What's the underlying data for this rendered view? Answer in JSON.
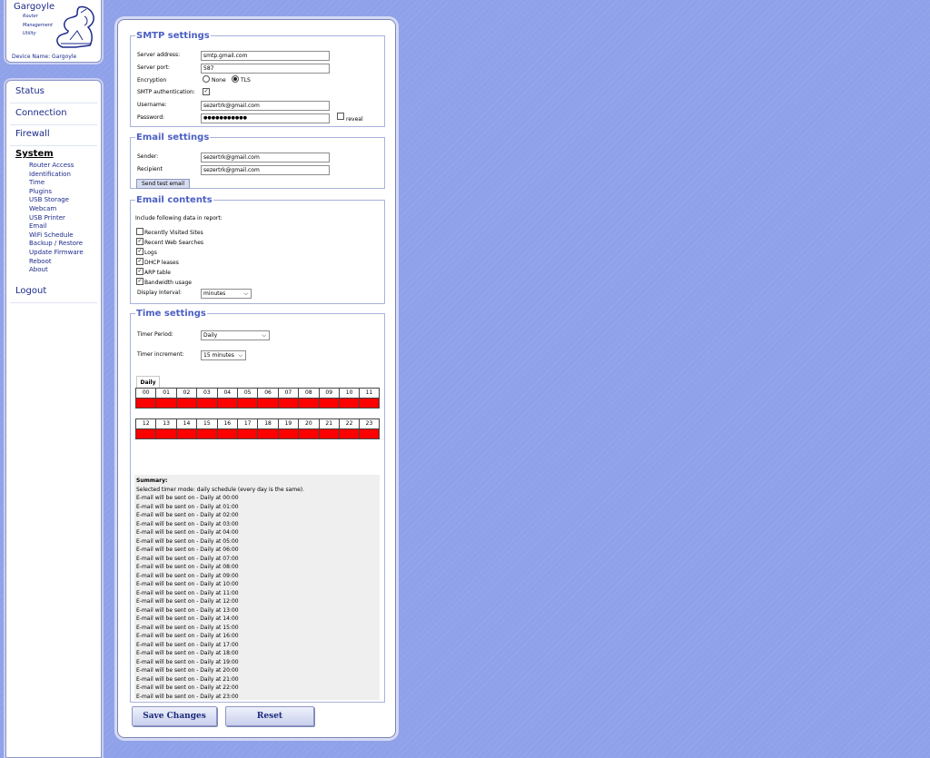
{
  "logo": {
    "title": "Gargoyle",
    "sub1": "Router",
    "sub2": "Management",
    "sub3": "Utility",
    "device": "Device Name: Gargoyle"
  },
  "nav": {
    "items": [
      "Status",
      "Connection",
      "Firewall"
    ],
    "current": "System",
    "sub_items": [
      "Router Access",
      "Identification",
      "Time",
      "Plugins",
      "USB Storage",
      "Webcam",
      "USB Printer",
      "Email",
      "WiFi Schedule",
      "Backup / Restore",
      "Update Firmware",
      "Reboot",
      "About"
    ],
    "logout": "Logout"
  },
  "smtp": {
    "legend": "SMTP settings",
    "server_address_label": "Server address:",
    "server_address": "smtp.gmail.com",
    "server_port_label": "Server port:",
    "server_port": "587",
    "encryption_label": "Encryption",
    "enc_none": "None",
    "enc_tls": "TLS",
    "auth_label": "SMTP authentication:",
    "username_label": "Username:",
    "username": "sezertrk@gmail.com",
    "password_label": "Password:",
    "password": "●●●●●●●●●●●",
    "reveal_label": "reveal"
  },
  "email_settings": {
    "legend": "Email settings",
    "sender_label": "Sender:",
    "sender": "sezertrk@gmail.com",
    "recipient_label": "Recipient",
    "recipient": "sezertrk@gmail.com",
    "send_test": "Send test email"
  },
  "email_contents": {
    "legend": "Email contents",
    "intro": "Include following data in report:",
    "opt_visited": "Recently Visited Sites",
    "opt_searches": "Recent Web Searches",
    "opt_logs": "Logs",
    "opt_dhcp": "DHCP leases",
    "opt_arp": "ARP table",
    "opt_bandwidth": "Bandwidth usage",
    "interval_label": "Display Interval:",
    "interval_value": "minutes"
  },
  "time": {
    "legend": "Time settings",
    "period_label": "Timer Period:",
    "period_value": "Daily",
    "increment_label": "Timer increment:",
    "increment_value": "15 minutes",
    "tab_label": "Daily",
    "hours_row1": [
      "00",
      "01",
      "02",
      "03",
      "04",
      "05",
      "06",
      "07",
      "08",
      "09",
      "10",
      "11"
    ],
    "hours_row2": [
      "12",
      "13",
      "14",
      "15",
      "16",
      "17",
      "18",
      "19",
      "20",
      "21",
      "22",
      "23"
    ],
    "active_color": "#ff0000",
    "summary_title": "Summary:",
    "summary_mode": "Selected timer mode: daily schedule (every day is the same).",
    "summary_lines": [
      "E-mail will be sent on - Daily at 00:00",
      "E-mail will be sent on - Daily at 01:00",
      "E-mail will be sent on - Daily at 02:00",
      "E-mail will be sent on - Daily at 03:00",
      "E-mail will be sent on - Daily at 04:00",
      "E-mail will be sent on - Daily at 05:00",
      "E-mail will be sent on - Daily at 06:00",
      "E-mail will be sent on - Daily at 07:00",
      "E-mail will be sent on - Daily at 08:00",
      "E-mail will be sent on - Daily at 09:00",
      "E-mail will be sent on - Daily at 10:00",
      "E-mail will be sent on - Daily at 11:00",
      "E-mail will be sent on - Daily at 12:00",
      "E-mail will be sent on - Daily at 13:00",
      "E-mail will be sent on - Daily at 14:00",
      "E-mail will be sent on - Daily at 15:00",
      "E-mail will be sent on - Daily at 16:00",
      "E-mail will be sent on - Daily at 17:00",
      "E-mail will be sent on - Daily at 18:00",
      "E-mail will be sent on - Daily at 19:00",
      "E-mail will be sent on - Daily at 20:00",
      "E-mail will be sent on - Daily at 21:00",
      "E-mail will be sent on - Daily at 22:00",
      "E-mail will be sent on - Daily at 23:00"
    ]
  },
  "actions": {
    "save": "Save Changes",
    "reset": "Reset"
  }
}
